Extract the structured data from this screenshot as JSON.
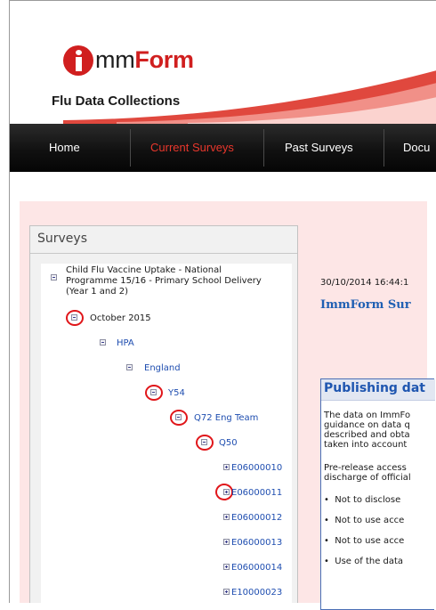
{
  "header": {
    "logo_prefix": "mm",
    "logo_bold": "Form",
    "subtitle": "Flu Data Collections"
  },
  "nav": {
    "items": [
      "Home",
      "Current Surveys",
      "Past Surveys",
      "Docu"
    ],
    "active": "Current Surveys"
  },
  "surveys": {
    "title": "Surveys",
    "tree": [
      {
        "label": "Child Flu Vaccine Uptake - National",
        "cont1": "Programme 15/16 - Primary School Delivery",
        "cont2": "(Year 1 and 2)",
        "state": "expanded",
        "circled": false
      },
      {
        "label": "October 2015",
        "state": "expanded",
        "circled": true
      },
      {
        "label": "HPA",
        "state": "expanded",
        "circled": false
      },
      {
        "label": "England",
        "state": "expanded",
        "circled": false
      },
      {
        "label": "Y54",
        "state": "expanded",
        "circled": true
      },
      {
        "label": "Q72 Eng Team",
        "state": "expanded",
        "circled": true
      },
      {
        "label": "Q50",
        "state": "expanded",
        "circled": true
      },
      {
        "label": "E06000010",
        "state": "collapsed",
        "circled": false
      },
      {
        "label": "E06000011",
        "state": "collapsed",
        "circled": true
      },
      {
        "label": "E06000012",
        "state": "collapsed",
        "circled": false
      },
      {
        "label": "E06000013",
        "state": "collapsed",
        "circled": false
      },
      {
        "label": "E06000014",
        "state": "collapsed",
        "circled": false
      },
      {
        "label": "E10000023",
        "state": "collapsed",
        "circled": false
      }
    ]
  },
  "content": {
    "timestamp": "30/10/2014 16:44:1",
    "heading": "ImmForm Sur",
    "publishing": {
      "title": "Publishing dat",
      "paragraph1": [
        "The data on ImmFo",
        "guidance on data q",
        "described and obta",
        "taken into account"
      ],
      "paragraph2": [
        "Pre-release access",
        "discharge of official"
      ],
      "bullets": [
        "Not to disclose",
        "Not to use acce",
        "Not to use acce",
        "Use of the data"
      ]
    }
  },
  "colors": {
    "brand_red": "#d01f1f",
    "nav_active": "#e9372c",
    "link_blue": "#1f4eb0",
    "annotation_ring": "#e0161a",
    "pink_bg": "#fde6e6"
  },
  "icons": {
    "expander_expanded": "minus-box-icon",
    "expander_collapsed": "plus-box-icon"
  }
}
